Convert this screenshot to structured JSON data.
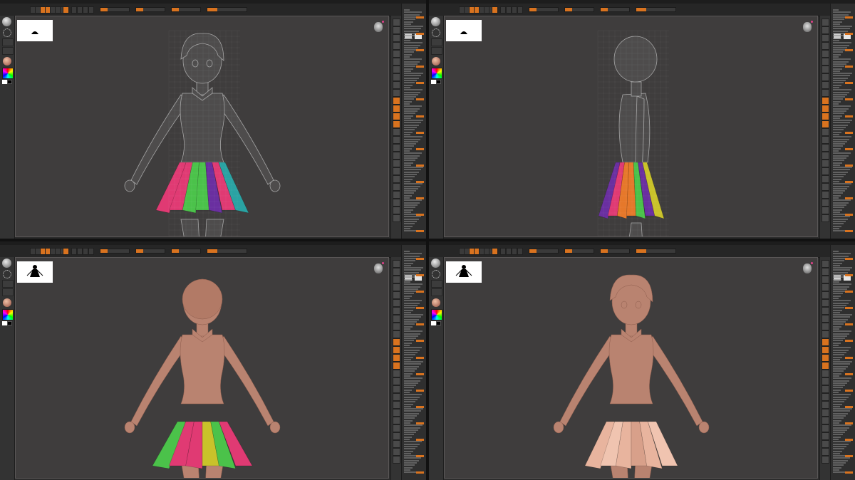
{
  "screens": [
    {
      "id": "front-wireframe",
      "view": "front",
      "shading": "wireframe",
      "skirt": "multicolor"
    },
    {
      "id": "side-wireframe",
      "view": "side",
      "shading": "wireframe",
      "skirt": "multicolor"
    },
    {
      "id": "back-clay",
      "view": "back",
      "shading": "clay",
      "skirt": "multicolor"
    },
    {
      "id": "three-quarter-clay",
      "view": "three-quarter",
      "shading": "clay",
      "skirt": "skin"
    }
  ],
  "colors": {
    "accent": "#d9731f",
    "ui_bg": "#2c2c2c",
    "canvas_bg": "#3f3d3d",
    "clay": "#b98370",
    "wire": "#9a9a9a",
    "skirt_pink": "#e03a73",
    "skirt_green": "#4bc24a",
    "skirt_purple": "#6a2fa0",
    "skirt_orange": "#e6782a",
    "skirt_teal": "#2aa3a3",
    "skirt_yellow": "#c9c22a",
    "skirt_skin": "#e8b49e"
  },
  "icons": {
    "brush": "sphere-brush-icon",
    "stroke": "dots-stroke-icon",
    "material": "matcap-material-icon",
    "color": "color-picker-icon",
    "gyro": "navigation-gyro-icon",
    "thumbnail": "silhouette-thumbnail-icon"
  }
}
